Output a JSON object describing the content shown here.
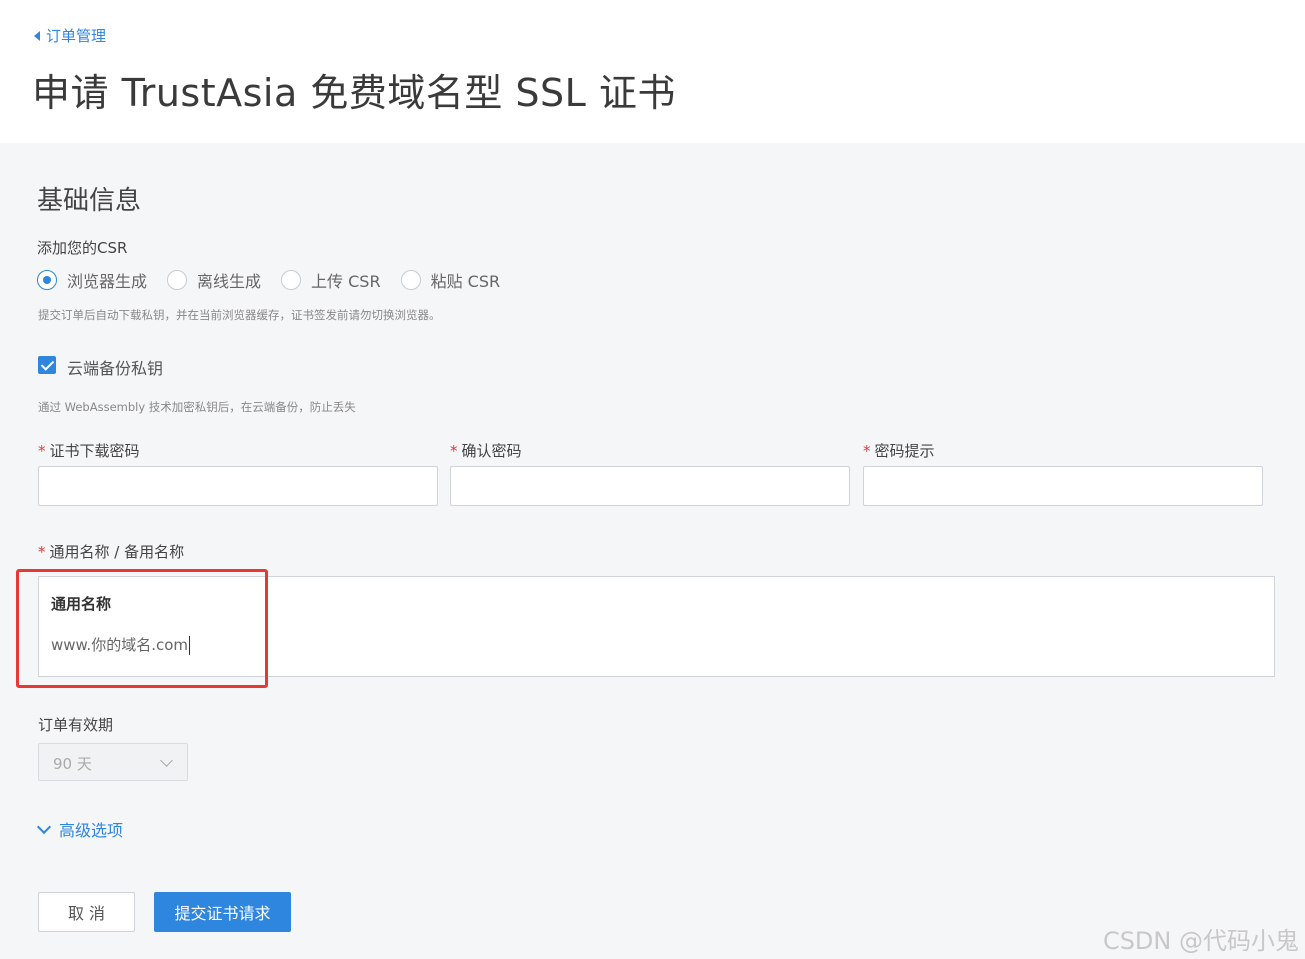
{
  "header": {
    "back_label": "订单管理",
    "title": "申请 TrustAsia 免费域名型 SSL 证书"
  },
  "basic": {
    "section_title": "基础信息",
    "csr_label": "添加您的CSR",
    "csr_options": [
      "浏览器生成",
      "离线生成",
      "上传 CSR",
      "粘贴 CSR"
    ],
    "csr_selected": "浏览器生成",
    "csr_hint": "提交订单后自动下载私钥，并在当前浏览器缓存，证书签发前请勿切换浏览器。",
    "backup_label": "云端备份私钥",
    "backup_checked": true,
    "backup_hint": "通过 WebAssembly 技术加密私钥后，在云端备份，防止丢失"
  },
  "password": {
    "download_label": "证书下载密码",
    "confirm_label": "确认密码",
    "hint_label": "密码提示",
    "required_mark": "*"
  },
  "names": {
    "label": "通用名称 / 备用名称",
    "common_name_title": "通用名称",
    "common_name_value": "www.你的域名.com"
  },
  "validity": {
    "label": "订单有效期",
    "selected": "90 天"
  },
  "advanced": {
    "label": "高级选项"
  },
  "actions": {
    "cancel": "取 消",
    "submit": "提交证书请求"
  },
  "colors": {
    "accent": "#2e86de",
    "required": "#e53935",
    "highlight_box": "#e53935"
  },
  "watermark": "CSDN @代码小鬼"
}
